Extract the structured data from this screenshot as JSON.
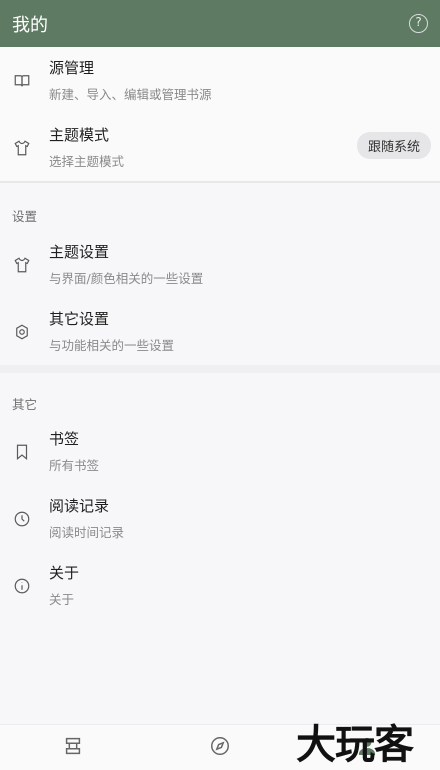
{
  "appbar": {
    "title": "我的",
    "help_icon": "?"
  },
  "top_items": [
    {
      "title": "源管理",
      "subtitle": "新建、导入、编辑或管理书源",
      "icon": "book-open-icon"
    },
    {
      "title": "主题模式",
      "subtitle": "选择主题模式",
      "icon": "tshirt-icon",
      "chip": "跟随系统"
    }
  ],
  "settings_section": {
    "label": "设置",
    "items": [
      {
        "title": "主题设置",
        "subtitle": "与界面/颜色相关的一些设置",
        "icon": "tshirt-icon"
      },
      {
        "title": "其它设置",
        "subtitle": "与功能相关的一些设置",
        "icon": "settings-icon"
      }
    ]
  },
  "other_section": {
    "label": "其它",
    "items": [
      {
        "title": "书签",
        "subtitle": "所有书签",
        "icon": "bookmark-icon"
      },
      {
        "title": "阅读记录",
        "subtitle": "阅读时间记录",
        "icon": "clock-icon"
      },
      {
        "title": "关于",
        "subtitle": "关于",
        "icon": "info-icon"
      }
    ]
  },
  "bottom_nav": {
    "items": [
      {
        "icon": "bookshelf-icon"
      },
      {
        "icon": "compass-icon"
      },
      {
        "icon": "person-icon"
      }
    ]
  },
  "watermark": "大玩客",
  "colors": {
    "appbar": "#5f7a63",
    "background": "#f7f7f9",
    "chip": "#e6e6e8"
  }
}
